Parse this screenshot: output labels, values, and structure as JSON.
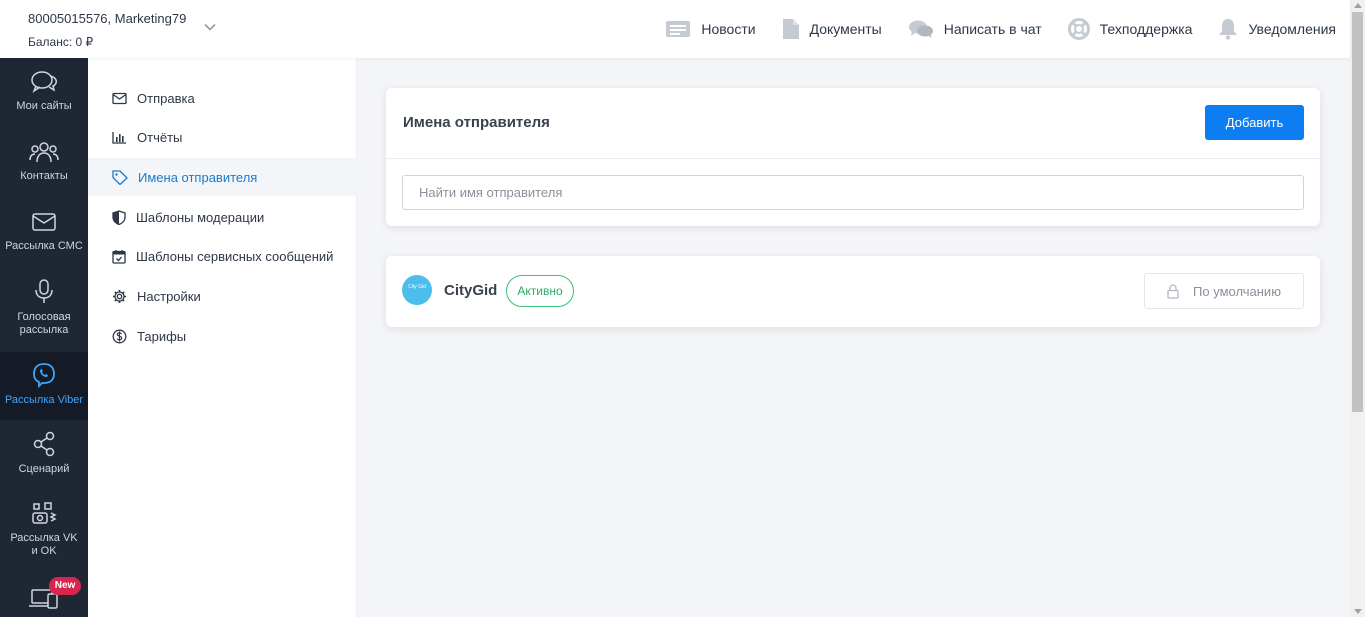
{
  "account": {
    "phone": "80005015576",
    "name": ", Marketing79",
    "balance": "Баланс: 0 ₽"
  },
  "topnav": [
    {
      "label": "Новости",
      "icon": "news-icon"
    },
    {
      "label": "Документы",
      "icon": "document-icon"
    },
    {
      "label": "Написать в чат",
      "icon": "chat-icon"
    },
    {
      "label": "Техподдержка",
      "icon": "lifebuoy-icon"
    },
    {
      "label": "Уведомления",
      "icon": "bell-icon"
    }
  ],
  "leftnav": [
    {
      "label": "Мои сайты",
      "icon": "chat-bubbles-icon"
    },
    {
      "label": "Контакты",
      "icon": "contacts-icon"
    },
    {
      "label": "Рассылка СМС",
      "icon": "envelope-icon"
    },
    {
      "label": "Голосовая рассылка",
      "icon": "microphone-icon"
    },
    {
      "label": "Рассылка Viber",
      "icon": "viber-icon",
      "active": true
    },
    {
      "label": "Сценарий",
      "icon": "share-icon"
    },
    {
      "label": "Рассылка VK и OK",
      "icon": "social-icon"
    },
    {
      "label": "",
      "icon": "devices-icon",
      "badge": "New"
    }
  ],
  "subnav": [
    {
      "label": "Отправка",
      "icon": "envelope-icon"
    },
    {
      "label": "Отчёты",
      "icon": "bar-chart-icon"
    },
    {
      "label": "Имена отправителя",
      "icon": "tag-icon",
      "active": true
    },
    {
      "label": "Шаблоны модерации",
      "icon": "shield-icon"
    },
    {
      "label": "Шаблоны сервисных сообщений",
      "icon": "calendar-icon"
    },
    {
      "label": "Настройки",
      "icon": "gear-icon"
    },
    {
      "label": "Тарифы",
      "icon": "dollar-icon"
    }
  ],
  "main": {
    "title": "Имена отправителя",
    "add_label": "Добавить",
    "search_placeholder": "Найти имя отправителя"
  },
  "senders": [
    {
      "avatar_text": "City Gid",
      "name": "CityGid",
      "status": "Активно",
      "default_label": "По умолчанию"
    }
  ],
  "colors": {
    "accent": "#0d7ef2",
    "active_nav": "#3ea6ff",
    "sidebar_bg": "#1f2735",
    "status_active": "#2ea96a",
    "badge": "#d7264d"
  }
}
